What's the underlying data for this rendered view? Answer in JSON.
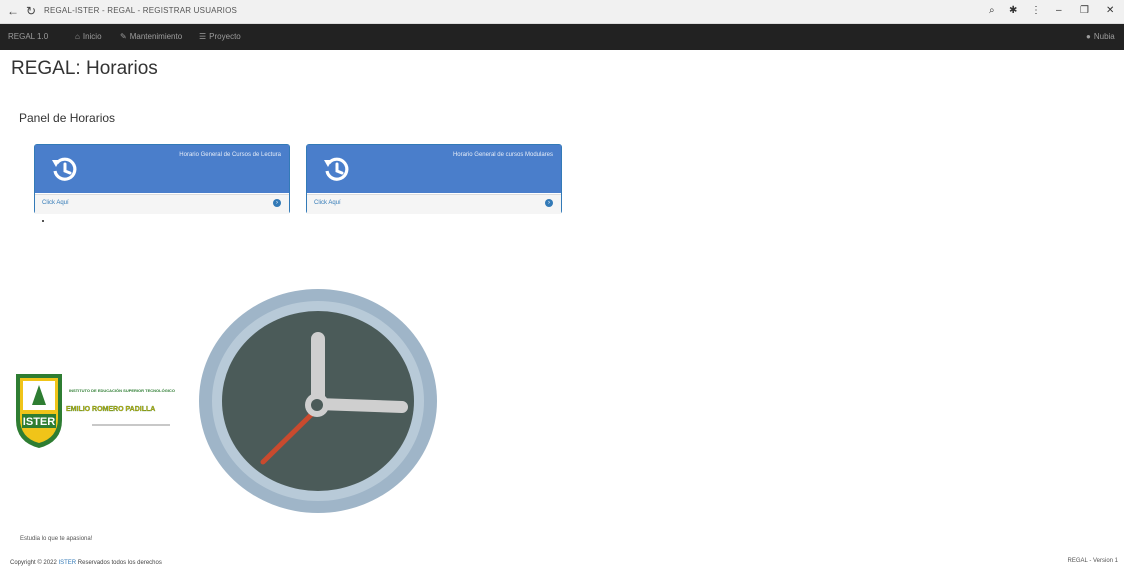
{
  "browser": {
    "url_text": "REGAL-ISTER - REGAL - REGISTRAR USUARIOS"
  },
  "navbar": {
    "brand": "REGAL 1.0",
    "items": [
      {
        "icon": "home-icon",
        "label": "Inicio"
      },
      {
        "icon": "wrench-icon",
        "label": "Mantenimiento"
      },
      {
        "icon": "list-icon",
        "label": "Proyecto"
      }
    ],
    "user_label": "Nubia"
  },
  "page": {
    "title": "REGAL: Horarios",
    "panel_title": "Panel de Horarios"
  },
  "cards": [
    {
      "caption": "Horario General de Cursos de Lectura",
      "link": "Click Aquí"
    },
    {
      "caption": "Horario General de cursos Modulares",
      "link": "Click Aquí"
    }
  ],
  "logo": {
    "line1": "INSTITUTO DE EDUCACIÓN SUPERIOR TECNOLÓGICO",
    "line2": "EMILIO ROMERO PADILLA",
    "badge": "ISTER"
  },
  "footer": {
    "tagline": "Estudia lo que te apasiona!",
    "copyright_prefix": "Copyright © 2022",
    "copyright_brand": "ISTER",
    "copyright_suffix": "Reservados todos los derechos",
    "version": "REGAL - Version 1"
  },
  "colors": {
    "navbar_bg": "#222222",
    "card_header": "#4a7ecb",
    "link": "#337ab7",
    "clock_ring": "#8fa9bf",
    "clock_face": "#4a5a58",
    "second_hand": "#c94a2e"
  }
}
